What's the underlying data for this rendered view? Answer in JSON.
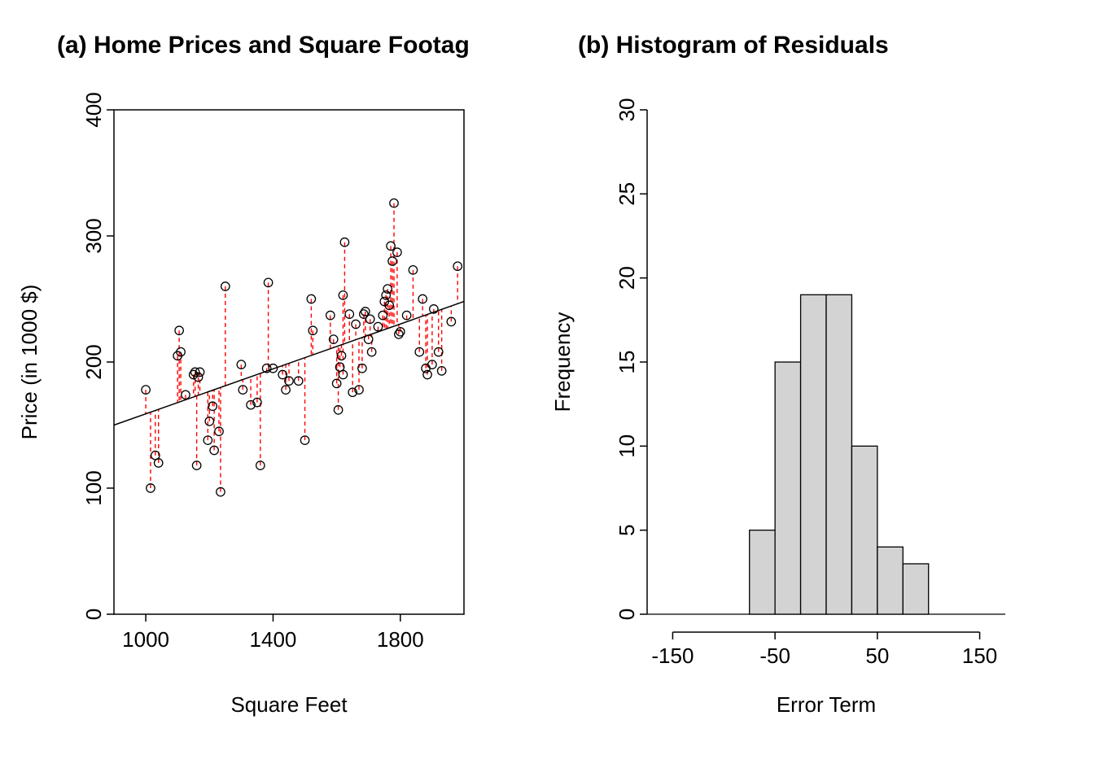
{
  "chart_data": [
    {
      "type": "scatter",
      "title": "(a) Home Prices and Square Footag",
      "xlabel": "Square Feet",
      "ylabel": "Price (in 1000 $)",
      "xlim": [
        900,
        2000
      ],
      "ylim": [
        0,
        400
      ],
      "xticks": [
        1000,
        1400,
        1800
      ],
      "yticks": [
        0,
        100,
        200,
        300,
        400
      ],
      "regression": {
        "x1": 900,
        "y1": 150,
        "x2": 2000,
        "y2": 248
      },
      "_note": "values estimated from plot; residuals drawn as dashed red verticals to regression line",
      "points": [
        {
          "x": 1000,
          "y": 178
        },
        {
          "x": 1015,
          "y": 100
        },
        {
          "x": 1030,
          "y": 126
        },
        {
          "x": 1040,
          "y": 120
        },
        {
          "x": 1100,
          "y": 205
        },
        {
          "x": 1105,
          "y": 225
        },
        {
          "x": 1110,
          "y": 208
        },
        {
          "x": 1125,
          "y": 174
        },
        {
          "x": 1150,
          "y": 190
        },
        {
          "x": 1155,
          "y": 192
        },
        {
          "x": 1160,
          "y": 118
        },
        {
          "x": 1165,
          "y": 188
        },
        {
          "x": 1170,
          "y": 192
        },
        {
          "x": 1195,
          "y": 138
        },
        {
          "x": 1200,
          "y": 153
        },
        {
          "x": 1210,
          "y": 165
        },
        {
          "x": 1215,
          "y": 130
        },
        {
          "x": 1230,
          "y": 145
        },
        {
          "x": 1235,
          "y": 97
        },
        {
          "x": 1250,
          "y": 260
        },
        {
          "x": 1300,
          "y": 198
        },
        {
          "x": 1305,
          "y": 178
        },
        {
          "x": 1330,
          "y": 166
        },
        {
          "x": 1350,
          "y": 168
        },
        {
          "x": 1360,
          "y": 118
        },
        {
          "x": 1380,
          "y": 195
        },
        {
          "x": 1385,
          "y": 263
        },
        {
          "x": 1400,
          "y": 195
        },
        {
          "x": 1430,
          "y": 190
        },
        {
          "x": 1440,
          "y": 178
        },
        {
          "x": 1450,
          "y": 185
        },
        {
          "x": 1480,
          "y": 185
        },
        {
          "x": 1500,
          "y": 138
        },
        {
          "x": 1520,
          "y": 250
        },
        {
          "x": 1525,
          "y": 225
        },
        {
          "x": 1580,
          "y": 237
        },
        {
          "x": 1590,
          "y": 218
        },
        {
          "x": 1600,
          "y": 183
        },
        {
          "x": 1605,
          "y": 162
        },
        {
          "x": 1610,
          "y": 196
        },
        {
          "x": 1615,
          "y": 205
        },
        {
          "x": 1620,
          "y": 190
        },
        {
          "x": 1620,
          "y": 253
        },
        {
          "x": 1625,
          "y": 295
        },
        {
          "x": 1640,
          "y": 238
        },
        {
          "x": 1650,
          "y": 176
        },
        {
          "x": 1660,
          "y": 230
        },
        {
          "x": 1670,
          "y": 178
        },
        {
          "x": 1680,
          "y": 195
        },
        {
          "x": 1685,
          "y": 238
        },
        {
          "x": 1690,
          "y": 240
        },
        {
          "x": 1700,
          "y": 218
        },
        {
          "x": 1705,
          "y": 234
        },
        {
          "x": 1710,
          "y": 208
        },
        {
          "x": 1730,
          "y": 228
        },
        {
          "x": 1745,
          "y": 237
        },
        {
          "x": 1750,
          "y": 248
        },
        {
          "x": 1755,
          "y": 253
        },
        {
          "x": 1760,
          "y": 258
        },
        {
          "x": 1765,
          "y": 245
        },
        {
          "x": 1770,
          "y": 292
        },
        {
          "x": 1775,
          "y": 280
        },
        {
          "x": 1780,
          "y": 326
        },
        {
          "x": 1790,
          "y": 287
        },
        {
          "x": 1795,
          "y": 222
        },
        {
          "x": 1800,
          "y": 224
        },
        {
          "x": 1820,
          "y": 237
        },
        {
          "x": 1840,
          "y": 273
        },
        {
          "x": 1860,
          "y": 208
        },
        {
          "x": 1870,
          "y": 250
        },
        {
          "x": 1880,
          "y": 195
        },
        {
          "x": 1885,
          "y": 190
        },
        {
          "x": 1900,
          "y": 198
        },
        {
          "x": 1905,
          "y": 242
        },
        {
          "x": 1920,
          "y": 208
        },
        {
          "x": 1930,
          "y": 193
        },
        {
          "x": 1960,
          "y": 232
        },
        {
          "x": 1980,
          "y": 276
        }
      ]
    },
    {
      "type": "bar",
      "title": "(b) Histogram of Residuals",
      "xlabel": "Error Term",
      "ylabel": "Frequency",
      "xlim": [
        -175,
        175
      ],
      "ylim": [
        0,
        30
      ],
      "xticks": [
        -150,
        -50,
        50,
        150
      ],
      "yticks": [
        0,
        5,
        10,
        15,
        20,
        25,
        30
      ],
      "bin_width": 25,
      "bins": [
        {
          "lo": -75,
          "hi": -50,
          "count": 5
        },
        {
          "lo": -50,
          "hi": -25,
          "count": 15
        },
        {
          "lo": -25,
          "hi": 0,
          "count": 19
        },
        {
          "lo": 0,
          "hi": 25,
          "count": 19
        },
        {
          "lo": 25,
          "hi": 50,
          "count": 10
        },
        {
          "lo": 50,
          "hi": 75,
          "count": 4
        },
        {
          "lo": 75,
          "hi": 100,
          "count": 3
        }
      ]
    }
  ]
}
